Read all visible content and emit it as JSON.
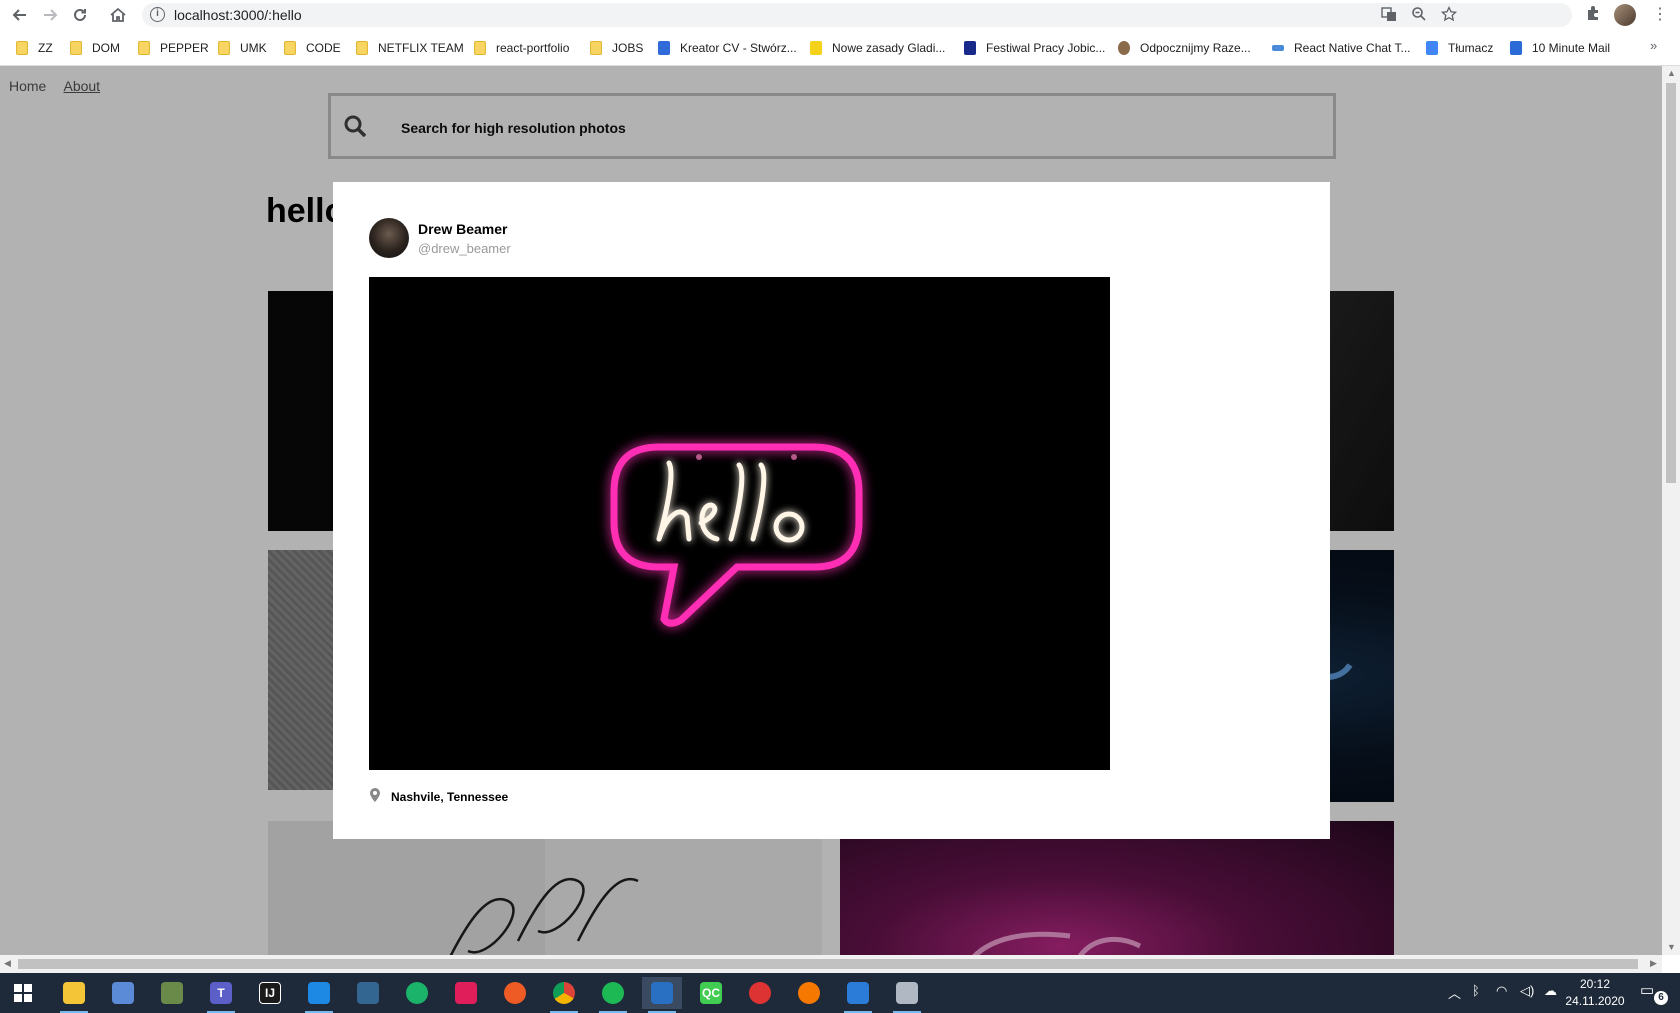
{
  "browser": {
    "url": "localhost:3000/:hello",
    "bookmarks": [
      {
        "label": "ZZ",
        "icon": "folder-icon"
      },
      {
        "label": "DOM",
        "icon": "folder-icon"
      },
      {
        "label": "PEPPER",
        "icon": "folder-icon"
      },
      {
        "label": "UMK",
        "icon": "folder-icon"
      },
      {
        "label": "CODE",
        "icon": "folder-icon"
      },
      {
        "label": "NETFLIX TEAM",
        "icon": "folder-icon"
      },
      {
        "label": "react-portfolio",
        "icon": "folder-icon"
      },
      {
        "label": "JOBS",
        "icon": "folder-icon"
      },
      {
        "label": "Kreator CV - Stwórz...",
        "icon": "kreator-icon"
      },
      {
        "label": "Nowe zasady Gladi...",
        "icon": "gladi-icon"
      },
      {
        "label": "Festiwal Pracy Jobic...",
        "icon": "jobicon-icon"
      },
      {
        "label": "Odpocznijmy Raze...",
        "icon": "person-icon"
      },
      {
        "label": "React Native Chat T...",
        "icon": "react-icon"
      },
      {
        "label": "Tłumacz",
        "icon": "translate-icon"
      },
      {
        "label": "10 Minute Mail",
        "icon": "mail-icon"
      }
    ],
    "more_bookmarks": "»"
  },
  "page": {
    "nav": {
      "home": "Home",
      "about": "About"
    },
    "search_placeholder": "Search for high resolution photos",
    "title": "hello"
  },
  "modal": {
    "user_name": "Drew Beamer",
    "user_handle": "@drew_beamer",
    "location": "Nashvile, Tennessee",
    "photo": {
      "neon_text": "hello",
      "neon_color": "#ff2fb4",
      "text_color": "#fff6e8"
    }
  },
  "taskbar": {
    "apps": [
      {
        "name": "file-explorer",
        "letter": "",
        "color": "#f3c537"
      },
      {
        "name": "network-app",
        "letter": "",
        "color": "#5b8bd6"
      },
      {
        "name": "scanner-app",
        "letter": "",
        "color": "#6a8a4a"
      },
      {
        "name": "teams",
        "letter": "T",
        "color": "#5b5fc7"
      },
      {
        "name": "intellij",
        "letter": "IJ",
        "color": "#1a1a1a"
      },
      {
        "name": "vscode",
        "letter": "",
        "color": "#1e88e5"
      },
      {
        "name": "postgres",
        "letter": "",
        "color": "#336791"
      },
      {
        "name": "gitkraken",
        "letter": "",
        "color": "#1bb26a"
      },
      {
        "name": "slack",
        "letter": "",
        "color": "#e01e5a"
      },
      {
        "name": "postman",
        "letter": "",
        "color": "#ef5b25"
      },
      {
        "name": "chrome",
        "letter": "",
        "color": "#db4437"
      },
      {
        "name": "spotify",
        "letter": "",
        "color": "#1db954"
      },
      {
        "name": "sourcetree",
        "letter": "",
        "color": "#2a70c2"
      },
      {
        "name": "qt-creator",
        "letter": "QC",
        "color": "#41cd52"
      },
      {
        "name": "vpn-app",
        "letter": "",
        "color": "#d33"
      },
      {
        "name": "blender-app",
        "letter": "",
        "color": "#f57900"
      },
      {
        "name": "media-app",
        "letter": "",
        "color": "#2b7bd8"
      },
      {
        "name": "notepad-app",
        "letter": "",
        "color": "#b0b8c4"
      }
    ],
    "time": "20:12",
    "date": "24.11.2020",
    "notifications": "6"
  }
}
